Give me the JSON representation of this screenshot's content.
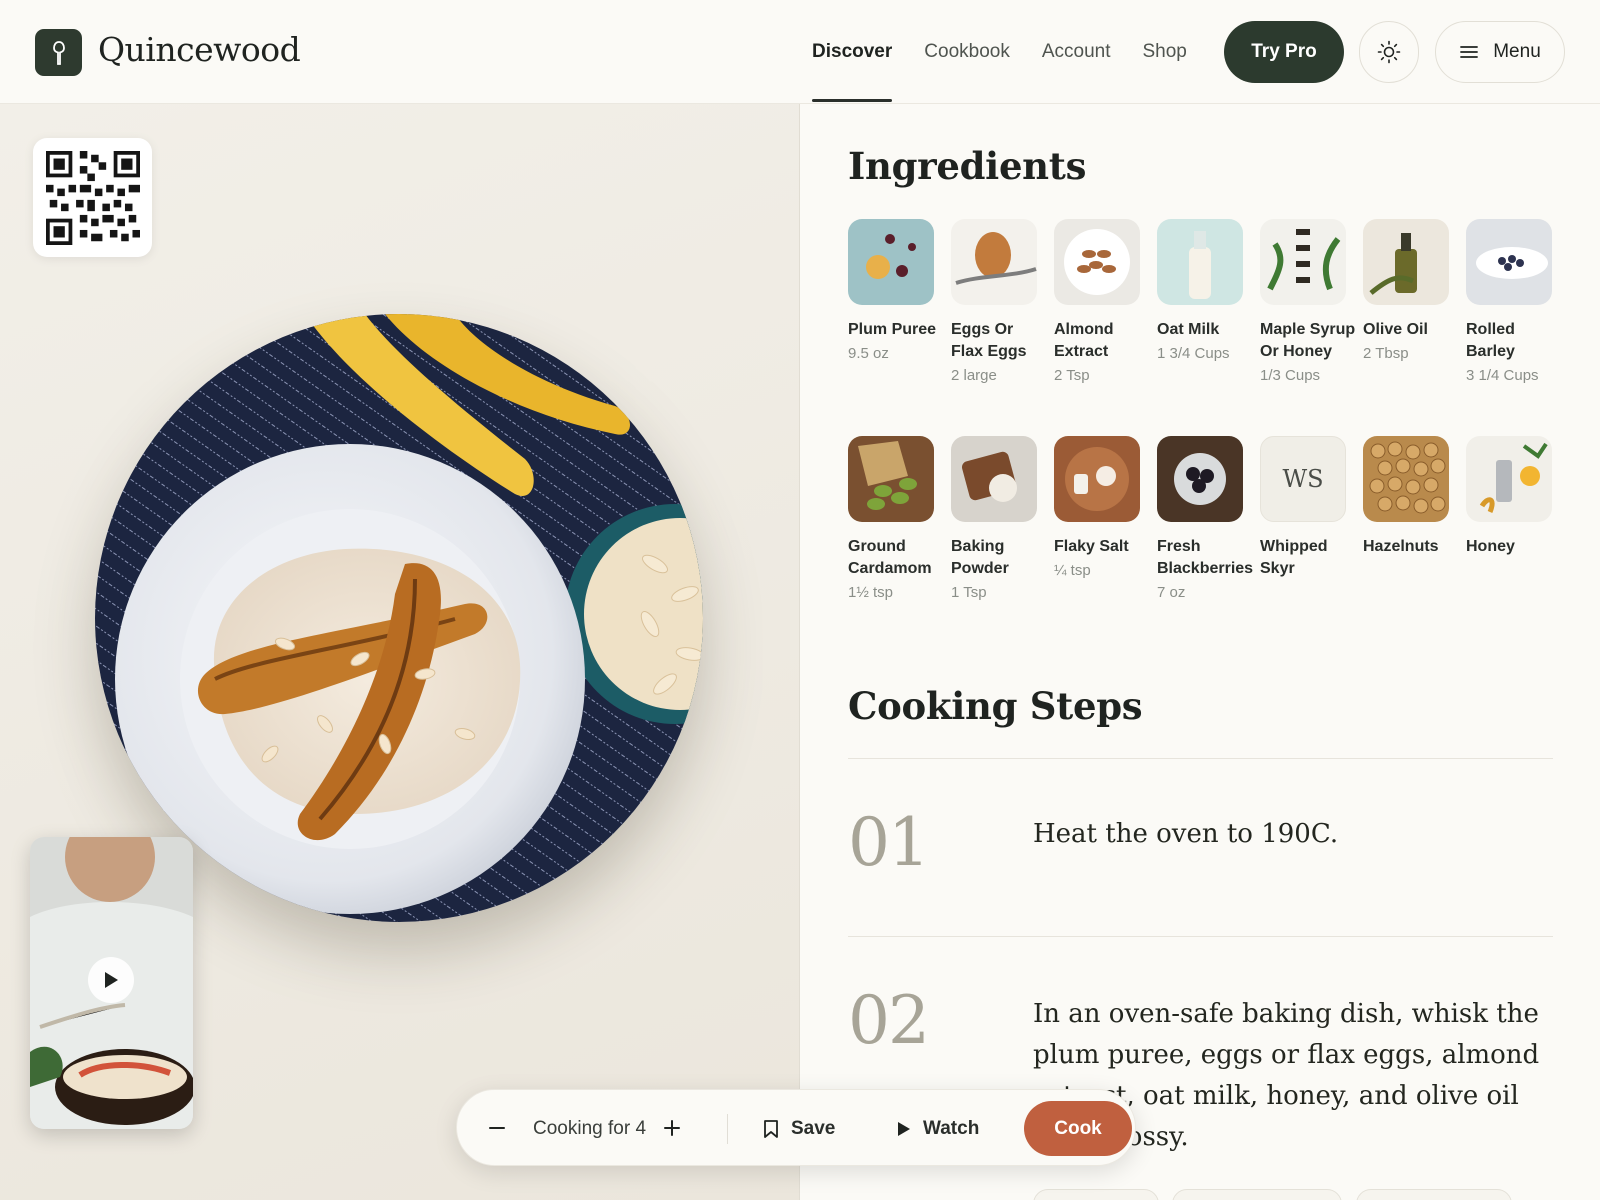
{
  "brand": {
    "name": "Quincewood",
    "logo_icon": "fork-icon"
  },
  "nav": {
    "items": [
      {
        "label": "Discover",
        "active": true
      },
      {
        "label": "Cookbook",
        "active": false
      },
      {
        "label": "Account",
        "active": false
      },
      {
        "label": "Shop",
        "active": false
      }
    ],
    "try_pro_label": "Try Pro",
    "theme_icon": "sun-icon",
    "menu_label": "Menu",
    "menu_icon": "hamburger-icon"
  },
  "hero": {
    "qr_icon": "qr-code-icon",
    "video_play_icon": "play-icon"
  },
  "ingredients": {
    "title": "Ingredients",
    "items": [
      {
        "name": "Plum Puree",
        "qty": "9.5 oz"
      },
      {
        "name": "Eggs Or Flax Eggs",
        "qty": "2 large"
      },
      {
        "name": "Almond Extract",
        "qty": "2 Tsp"
      },
      {
        "name": "Oat Milk",
        "qty": "1 3/4 Cups"
      },
      {
        "name": "Maple Syrup Or Honey",
        "qty": "1/3 Cups"
      },
      {
        "name": "Olive Oil",
        "qty": "2 Tbsp"
      },
      {
        "name": "Rolled Barley",
        "qty": "3 1/4 Cups"
      },
      {
        "name": "Ground Cardamom",
        "qty": "1½ tsp"
      },
      {
        "name": "Baking Powder",
        "qty": "1 Tsp"
      },
      {
        "name": "Flaky Salt",
        "qty": "¼ tsp"
      },
      {
        "name": "Fresh Blackberries",
        "qty": "7 oz"
      },
      {
        "name": "Whipped Skyr",
        "qty": "",
        "initials": "WS"
      },
      {
        "name": "Hazelnuts",
        "qty": ""
      },
      {
        "name": "Honey",
        "qty": ""
      }
    ]
  },
  "steps": {
    "title": "Cooking Steps",
    "items": [
      {
        "num": "01",
        "text": "Heat the oven to 190C."
      },
      {
        "num": "02",
        "text": "In an oven-safe baking dish, whisk the plum puree, eggs or flax eggs, almond extract, oat milk, honey, and olive oil until glossy."
      }
    ]
  },
  "toolbar": {
    "servings_label": "Cooking for 4",
    "minus_icon": "minus-icon",
    "plus_icon": "plus-icon",
    "save_label": "Save",
    "save_icon": "bookmark-icon",
    "watch_label": "Watch",
    "watch_icon": "play-icon",
    "cook_label": "Cook"
  },
  "colors": {
    "brand_dark": "#2c3a2e",
    "accent_cook": "#c0603f",
    "background": "#fbfaf6"
  }
}
